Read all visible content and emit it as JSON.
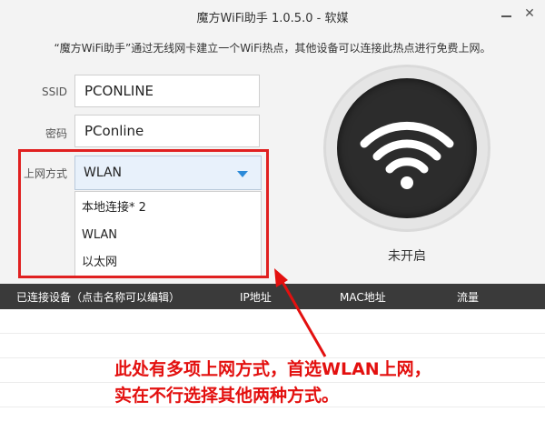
{
  "window": {
    "title": "魔方WiFi助手 1.0.5.0 - 软媒",
    "min_label": "—",
    "close_label": "✕"
  },
  "subtitle": "“魔方WiFi助手”通过无线网卡建立一个WiFi热点，其他设备可以连接此热点进行免费上网。",
  "form": {
    "ssid_label": "SSID",
    "ssid_value": "PCONLINE",
    "password_label": "密码",
    "password_value": "PConline",
    "network_label": "上网方式",
    "network_selected": "WLAN",
    "network_options": [
      "本地连接* 2",
      "WLAN",
      "以太网"
    ]
  },
  "hotspot": {
    "icon": "wifi-icon",
    "status": "未开启"
  },
  "table": {
    "columns": [
      "已连接设备（点击名称可以编辑）",
      "IP地址",
      "MAC地址",
      "流量"
    ]
  },
  "annotation": {
    "line1": "此处有多项上网方式，首选WLAN上网，",
    "line2": "实在不行选择其他两种方式。",
    "color": "#e3100f"
  },
  "colors": {
    "highlight": "#e02020",
    "table_header": "#3a3a3a",
    "dropdown_arrow": "#2b8ad8"
  }
}
